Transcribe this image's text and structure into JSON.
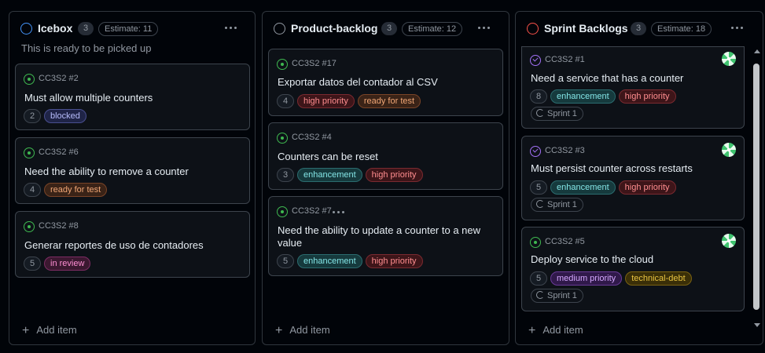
{
  "columns": [
    {
      "title": "Icebox",
      "status_color": "#4493f8",
      "count": "3",
      "estimate": "Estimate: 11",
      "description": "This is ready to be picked up",
      "add_item": "Add item",
      "cards": [
        {
          "ref": "CC3S2 #2",
          "state": "open",
          "title": "Must allow multiple counters",
          "points": "2",
          "labels": [
            {
              "text": "blocked",
              "kind": "blocked"
            }
          ]
        },
        {
          "ref": "CC3S2 #6",
          "state": "open",
          "title": "Need the ability to remove a counter",
          "points": "4",
          "labels": [
            {
              "text": "ready for test",
              "kind": "ready"
            }
          ]
        },
        {
          "ref": "CC3S2 #8",
          "state": "open",
          "title": "Generar reportes de uso de contadores",
          "points": "5",
          "labels": [
            {
              "text": "in review",
              "kind": "review"
            }
          ]
        }
      ]
    },
    {
      "title": "Product-backlog",
      "status_color": "#9198a1",
      "count": "3",
      "estimate": "Estimate: 12",
      "add_item": "Add item",
      "cards": [
        {
          "ref": "CC3S2 #17",
          "state": "open",
          "title": "Exportar datos del contador al CSV",
          "points": "4",
          "labels": [
            {
              "text": "high priority",
              "kind": "high"
            },
            {
              "text": "ready for test",
              "kind": "ready"
            }
          ]
        },
        {
          "ref": "CC3S2 #4",
          "state": "open",
          "title": "Counters can be reset",
          "points": "3",
          "labels": [
            {
              "text": "enhancement",
              "kind": "enh"
            },
            {
              "text": "high priority",
              "kind": "high"
            }
          ]
        },
        {
          "ref": "CC3S2 #7",
          "state": "open",
          "title_line1": "Need the ability to update a counter to a new",
          "title_line2": "value",
          "points": "5",
          "labels": [
            {
              "text": "enhancement",
              "kind": "enh"
            },
            {
              "text": "high priority",
              "kind": "high"
            }
          ]
        }
      ]
    },
    {
      "title": "Sprint Backlogs",
      "status_color": "#f85149",
      "count": "3",
      "estimate": "Estimate: 18",
      "add_item": "Add item",
      "cards": [
        {
          "ref": "CC3S2 #1",
          "state": "closed",
          "title": "Need a service that has a counter",
          "points": "8",
          "labels": [
            {
              "text": "enhancement",
              "kind": "enh"
            },
            {
              "text": "high priority",
              "kind": "high"
            }
          ],
          "sprint": "Sprint 1"
        },
        {
          "ref": "CC3S2 #3",
          "state": "closed",
          "title": "Must persist counter across restarts",
          "points": "5",
          "labels": [
            {
              "text": "enhancement",
              "kind": "enh"
            },
            {
              "text": "high priority",
              "kind": "high"
            }
          ],
          "sprint": "Sprint 1"
        },
        {
          "ref": "CC3S2 #5",
          "state": "open",
          "title": "Deploy service to the cloud",
          "points": "5",
          "labels": [
            {
              "text": "medium priority",
              "kind": "medium"
            },
            {
              "text": "technical-debt",
              "kind": "tech"
            }
          ],
          "sprint": "Sprint 1"
        }
      ]
    }
  ]
}
